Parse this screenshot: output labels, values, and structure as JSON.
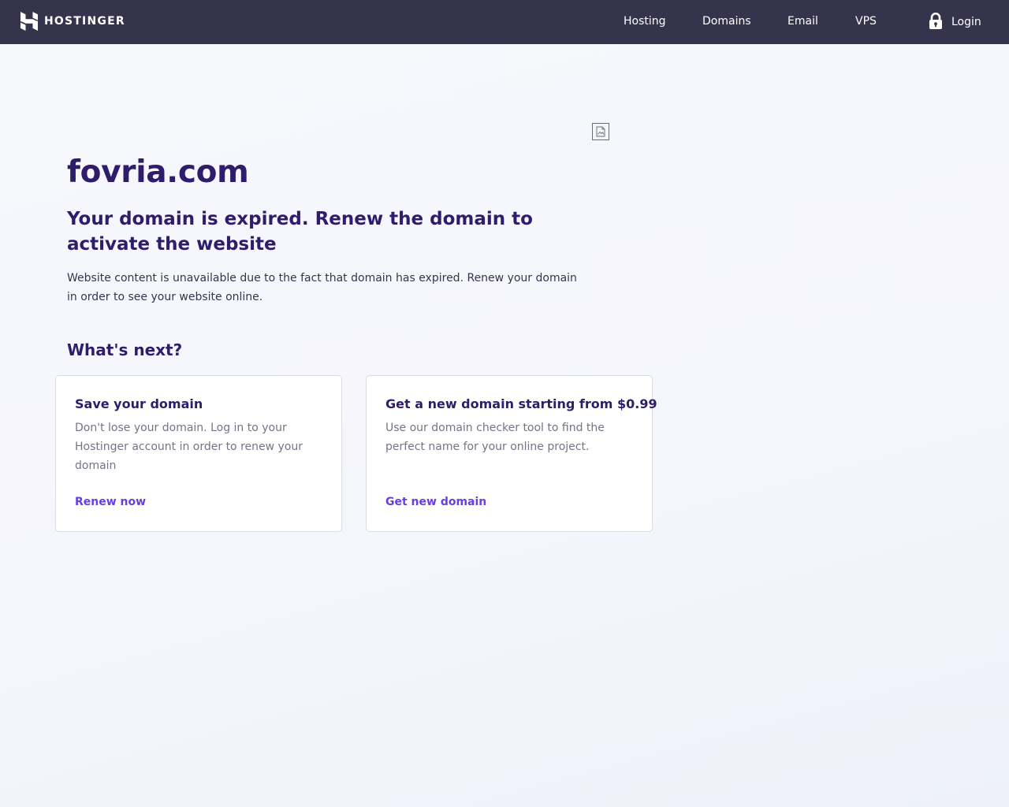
{
  "nav": {
    "brand": "HOSTINGER",
    "links": [
      "Hosting",
      "Domains",
      "Email",
      "VPS"
    ],
    "login": "Login"
  },
  "main": {
    "domain": "fovria.com",
    "subtitle": "Your domain is expired. Renew the domain to activate the website",
    "description": "Website content is unavailable due to the fact that domain has expired. Renew your domain in order to see your website online.",
    "whats_next": "What's next?"
  },
  "cards": [
    {
      "title": "Save your domain",
      "text": "Don't lose your domain. Log in to your Hostinger account in order to renew your domain",
      "link": "Renew now"
    },
    {
      "title": "Get a new domain starting from $0.99",
      "text": "Use our domain checker tool to find the perfect name for your online project.",
      "link": "Get new domain"
    }
  ],
  "colors": {
    "navbar": "#36344d",
    "heading": "#2f1c6a",
    "body_text": "#36344d",
    "muted_text": "#727586",
    "accent": "#673de6",
    "background": "#f5f6fc"
  },
  "icons": {
    "logo": "hostinger-logo-icon",
    "login": "lock-icon",
    "image": "broken-image-icon"
  }
}
